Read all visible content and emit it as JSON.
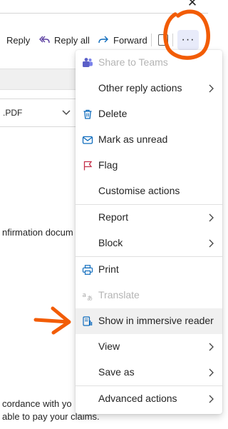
{
  "toolbar": {
    "reply_label": "Reply",
    "reply_all_label": "Reply all",
    "forward_label": "Forward",
    "more_label": "···"
  },
  "attachment": {
    "name": ".PDF"
  },
  "body": {
    "line1": "nfirmation docum",
    "line2": "cordance with yo",
    "line3": "able to pay your claims."
  },
  "menu": {
    "share_to_teams": "Share to Teams",
    "other_reply_actions": "Other reply actions",
    "delete": "Delete",
    "mark_as_unread": "Mark as unread",
    "flag": "Flag",
    "customise_actions": "Customise actions",
    "report": "Report",
    "block": "Block",
    "print": "Print",
    "translate": "Translate",
    "show_in_immersive_reader": "Show in immersive reader",
    "view": "View",
    "save_as": "Save as",
    "advanced_actions": "Advanced actions"
  },
  "colors": {
    "accent": "#0f6cbd",
    "teams": "#5b5fc7",
    "flag": "#c4314b",
    "annotation": "#f25c05"
  }
}
